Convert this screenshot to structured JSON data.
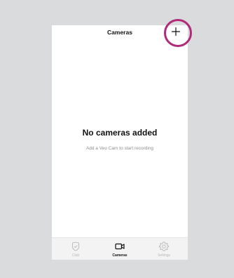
{
  "header": {
    "title": "Cameras",
    "add_icon": "plus-icon"
  },
  "empty_state": {
    "title": "No cameras added",
    "subtitle": "Add a Veo Cam to start recording"
  },
  "tabbar": {
    "items": [
      {
        "label": "Club",
        "icon": "shield-check-icon",
        "active": false
      },
      {
        "label": "Cameras",
        "icon": "video-camera-icon",
        "active": true
      },
      {
        "label": "Settings",
        "icon": "gear-icon",
        "active": false
      }
    ]
  },
  "colors": {
    "background": "#dadbdc",
    "screen": "#ffffff",
    "highlight_ring": "#b02a7a",
    "tab_inactive": "#b8b8b8",
    "tab_active": "#111111"
  }
}
